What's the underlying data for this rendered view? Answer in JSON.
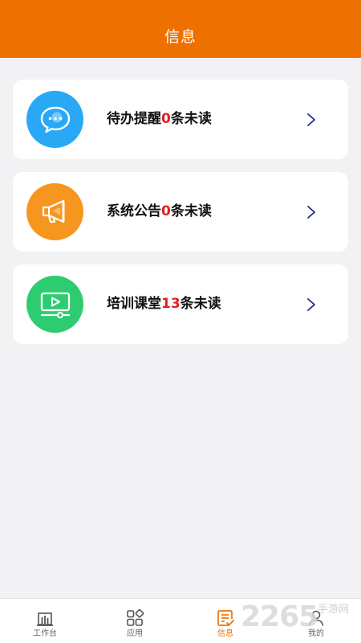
{
  "header": {
    "title": "信息"
  },
  "cards": [
    {
      "title": "待办提醒",
      "count": "0",
      "suffix": "条未读",
      "color": "#29a8f5",
      "icon": "chat-bubble-icon"
    },
    {
      "title": "系统公告",
      "count": "0",
      "suffix": "条未读",
      "color": "#f7961f",
      "icon": "megaphone-icon"
    },
    {
      "title": "培训课堂",
      "count": "13",
      "suffix": "条未读",
      "color": "#2ecc71",
      "icon": "video-player-icon"
    }
  ],
  "tabs": [
    {
      "label": "工作台",
      "icon": "bar-chart-icon",
      "active": false
    },
    {
      "label": "应用",
      "icon": "app-grid-icon",
      "active": false
    },
    {
      "label": "信息",
      "icon": "checklist-icon",
      "active": true
    },
    {
      "label": "我的",
      "icon": "person-icon",
      "active": false
    }
  ],
  "watermark": {
    "number": "2265",
    "text": "手游网"
  },
  "colors": {
    "accent": "#ee7100",
    "count_red": "#e02020",
    "chevron": "#1f2a8c"
  }
}
